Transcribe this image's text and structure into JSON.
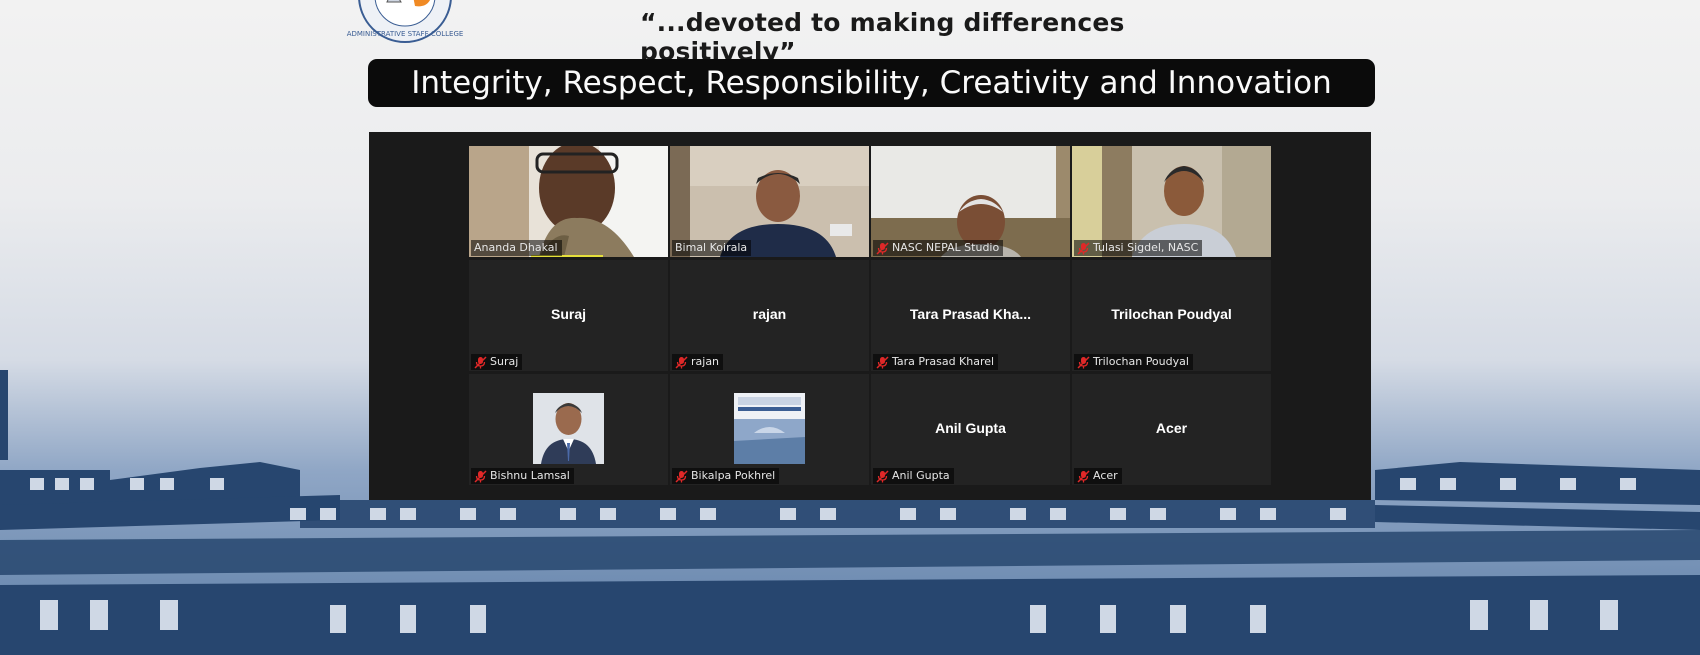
{
  "header": {
    "tagline": "“...devoted to making differences positively”",
    "values_banner": "Integrity, Respect, Responsibility, Creativity and Innovation",
    "logo_text": "ADMINISTRATIVE STAFF COLLEGE"
  },
  "gallery": {
    "tiles": [
      {
        "name": "Ananda Dhakal",
        "video": true,
        "muted": false,
        "active_speaker": true
      },
      {
        "name": "Bimal Koirala",
        "video": true,
        "muted": false
      },
      {
        "name": "NASC NEPAL Studio",
        "video": true,
        "muted": true
      },
      {
        "name": "Tulasi Sigdel, NASC",
        "video": true,
        "muted": true
      },
      {
        "name": "Suraj",
        "display": "Suraj",
        "video": false,
        "muted": true
      },
      {
        "name": "rajan",
        "display": "rajan",
        "video": false,
        "muted": true
      },
      {
        "name": "Tara Prasad Kharel",
        "display": "Tara Prasad Kha...",
        "video": false,
        "muted": true
      },
      {
        "name": "Trilochan Poudyal",
        "display": "Trilochan Poudyal",
        "video": false,
        "muted": true
      },
      {
        "name": "Bishnu Lamsal",
        "video": false,
        "avatar": "profile-photo",
        "muted": true
      },
      {
        "name": "Bikalpa Pokhrel",
        "video": false,
        "avatar": "college-image",
        "muted": true
      },
      {
        "name": "Anil Gupta",
        "display": "Anil Gupta",
        "video": false,
        "muted": true
      },
      {
        "name": "Acer",
        "display": "Acer",
        "video": false,
        "muted": true
      }
    ]
  },
  "colors": {
    "panel_bg": "#1a1a1a",
    "tile_bg": "#232323",
    "mute_icon": "#e02828",
    "speaker_highlight": "#e5df3b",
    "building_ink": "#27466f"
  },
  "icons": {
    "mute": "microphone-muted-icon"
  }
}
